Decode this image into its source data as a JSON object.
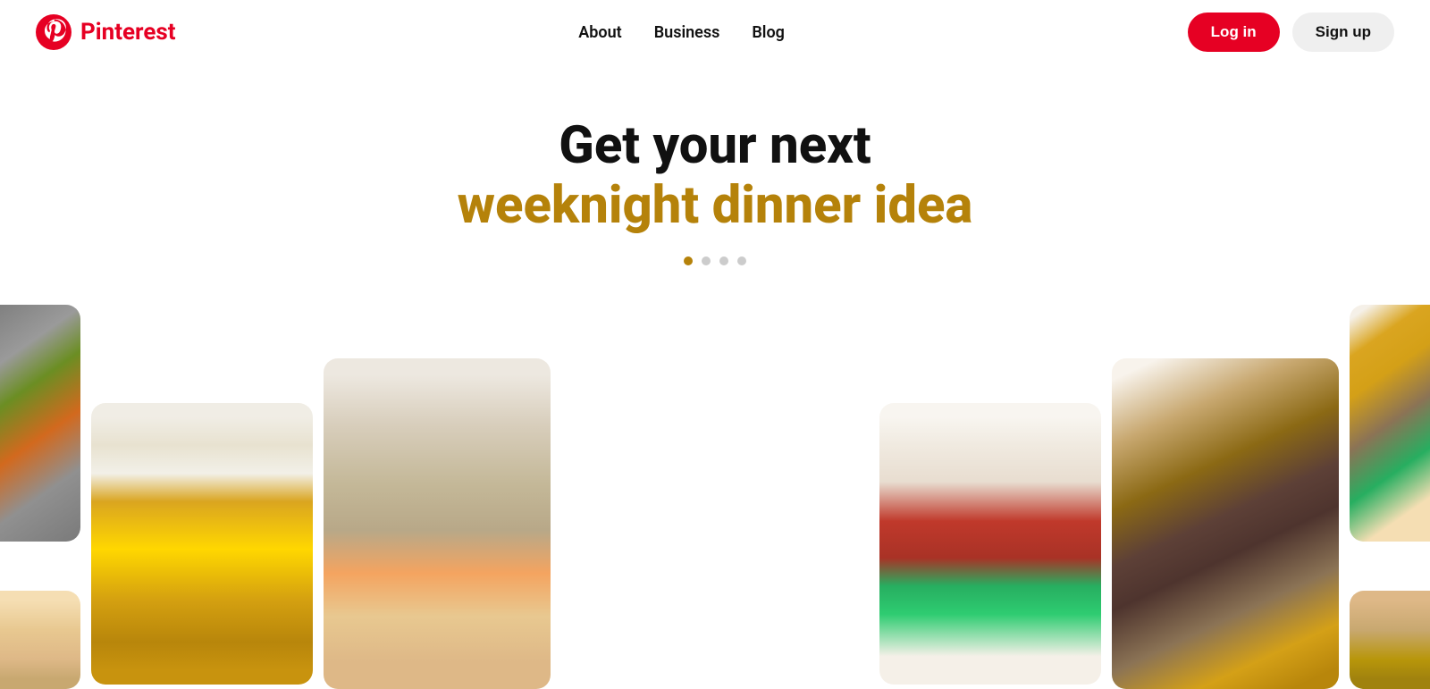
{
  "nav": {
    "logo_text": "Pinterest",
    "links": [
      {
        "label": "About",
        "id": "about"
      },
      {
        "label": "Business",
        "id": "business"
      },
      {
        "label": "Blog",
        "id": "blog"
      }
    ],
    "login_label": "Log in",
    "signup_label": "Sign up"
  },
  "hero": {
    "line1": "Get your next",
    "line2": "weeknight dinner idea",
    "dots": [
      {
        "active": true
      },
      {
        "active": false
      },
      {
        "active": false
      },
      {
        "active": false
      }
    ]
  },
  "colors": {
    "pinterest_red": "#E60023",
    "hero_accent": "#b5820a",
    "text_dark": "#111111"
  }
}
